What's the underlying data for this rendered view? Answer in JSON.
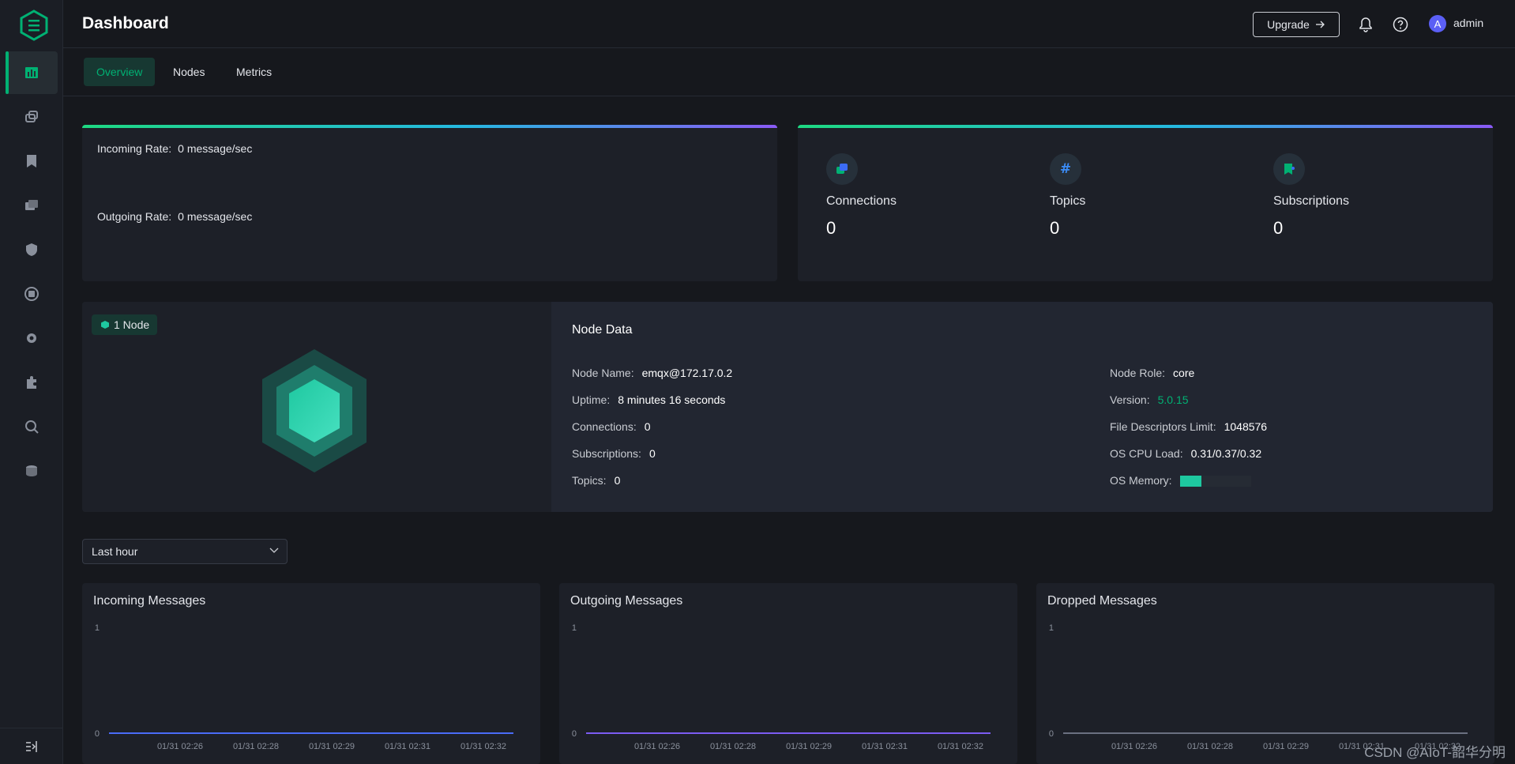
{
  "header": {
    "title": "Dashboard",
    "upgrade_label": "Upgrade",
    "user_initial": "A",
    "user_name": "admin"
  },
  "tabs": [
    {
      "label": "Overview",
      "active": true
    },
    {
      "label": "Nodes",
      "active": false
    },
    {
      "label": "Metrics",
      "active": false
    }
  ],
  "sidebar": {
    "items": [
      {
        "icon": "dashboard-icon",
        "active": true
      },
      {
        "icon": "connections-icon"
      },
      {
        "icon": "subscriptions-icon"
      },
      {
        "icon": "retained-icon"
      },
      {
        "icon": "access-control-icon"
      },
      {
        "icon": "integration-icon"
      },
      {
        "icon": "management-icon"
      },
      {
        "icon": "extensions-icon"
      },
      {
        "icon": "diagnose-icon"
      },
      {
        "icon": "system-icon"
      }
    ]
  },
  "rates": {
    "incoming_label": "Incoming Rate:",
    "incoming_value": "0 message/sec",
    "outgoing_label": "Outgoing Rate:",
    "outgoing_value": "0 message/sec"
  },
  "stats": [
    {
      "label": "Connections",
      "value": "0",
      "icon": "connections-icon"
    },
    {
      "label": "Topics",
      "value": "0",
      "icon": "topics-icon"
    },
    {
      "label": "Subscriptions",
      "value": "0",
      "icon": "subscriptions-icon"
    }
  ],
  "node": {
    "badge": "1 Node",
    "title": "Node Data",
    "left": [
      {
        "label": "Node Name:",
        "value": "emqx@172.17.0.2"
      },
      {
        "label": "Uptime:",
        "value": "8 minutes 16 seconds"
      },
      {
        "label": "Connections:",
        "value": "0"
      },
      {
        "label": "Subscriptions:",
        "value": "0"
      },
      {
        "label": "Topics:",
        "value": "0"
      }
    ],
    "right": [
      {
        "label": "Node Role:",
        "value": "core"
      },
      {
        "label": "Version:",
        "value": "5.0.15"
      },
      {
        "label": "File Descriptors Limit:",
        "value": "1048576"
      },
      {
        "label": "OS CPU Load:",
        "value": "0.31/0.37/0.32"
      },
      {
        "label": "OS Memory:",
        "value": ""
      }
    ],
    "os_memory_fraction": 0.3
  },
  "time_range": {
    "selected": "Last hour"
  },
  "charts": [
    {
      "title": "Incoming Messages",
      "color": "#4a6cf7"
    },
    {
      "title": "Outgoing Messages",
      "color": "#7b5cf2"
    },
    {
      "title": "Dropped Messages",
      "color": "#6b7080"
    }
  ],
  "chart_data": [
    {
      "type": "line",
      "title": "Incoming Messages",
      "x": [
        "01/31 02:26",
        "01/31 02:28",
        "01/31 02:29",
        "01/31 02:31",
        "01/31 02:32"
      ],
      "values": [
        0,
        0,
        0,
        0,
        0
      ],
      "ylim": [
        0,
        1
      ],
      "yticks": [
        "1",
        "0"
      ]
    },
    {
      "type": "line",
      "title": "Outgoing Messages",
      "x": [
        "01/31 02:26",
        "01/31 02:28",
        "01/31 02:29",
        "01/31 02:31",
        "01/31 02:32"
      ],
      "values": [
        0,
        0,
        0,
        0,
        0
      ],
      "ylim": [
        0,
        1
      ],
      "yticks": [
        "1",
        "0"
      ]
    },
    {
      "type": "line",
      "title": "Dropped Messages",
      "x": [
        "01/31 02:26",
        "01/31 02:28",
        "01/31 02:29",
        "01/31 02:31",
        "01/31 02:32"
      ],
      "values": [
        0,
        0,
        0,
        0,
        0
      ],
      "ylim": [
        0,
        1
      ],
      "yticks": [
        "1",
        "0"
      ]
    }
  ],
  "watermark": "CSDN @AIoT-韶华分明"
}
